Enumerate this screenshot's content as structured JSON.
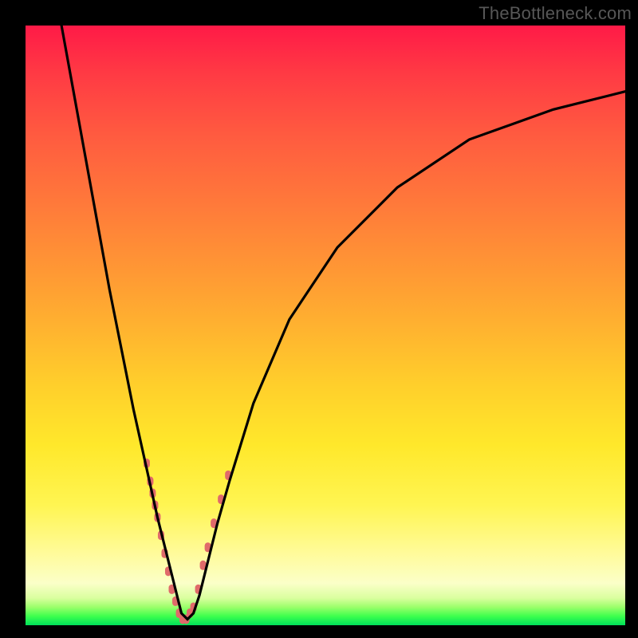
{
  "watermark": "TheBottleneck.com",
  "colors": {
    "background": "#000000",
    "gradient_top": "#ff1a47",
    "gradient_bottom": "#00e05a",
    "curve_stroke": "#000000",
    "marker_fill": "#e06a6a"
  },
  "chart_data": {
    "type": "line",
    "title": "",
    "xlabel": "",
    "ylabel": "",
    "xlim": [
      0,
      100
    ],
    "ylim": [
      0,
      100
    ],
    "note": "V-shaped bottleneck curve; x is normalized component ratio (0–100), y is bottleneck percentage (0 = none, 100 = severe). Minimum (no bottleneck) near x ≈ 26.",
    "series": [
      {
        "name": "bottleneck_curve",
        "x": [
          6,
          8,
          10,
          12,
          14,
          16,
          18,
          20,
          22,
          23,
          24,
          25,
          26,
          27,
          28,
          29,
          30,
          32,
          34,
          38,
          44,
          52,
          62,
          74,
          88,
          100
        ],
        "y": [
          100,
          89,
          78,
          67,
          56,
          46,
          36,
          27,
          18,
          14,
          10,
          6,
          2,
          1,
          2,
          5,
          9,
          17,
          24,
          37,
          51,
          63,
          73,
          81,
          86,
          89
        ]
      }
    ],
    "markers": {
      "name": "highlighted_points",
      "note": "Salmon rounded markers clustered near the minimum and lower flanks of the V.",
      "points": [
        {
          "x": 20.2,
          "y": 27
        },
        {
          "x": 20.8,
          "y": 24
        },
        {
          "x": 21.2,
          "y": 22
        },
        {
          "x": 21.6,
          "y": 20
        },
        {
          "x": 22.0,
          "y": 18
        },
        {
          "x": 22.6,
          "y": 15
        },
        {
          "x": 23.2,
          "y": 12
        },
        {
          "x": 23.8,
          "y": 9
        },
        {
          "x": 24.4,
          "y": 6
        },
        {
          "x": 25.0,
          "y": 4
        },
        {
          "x": 25.6,
          "y": 2
        },
        {
          "x": 26.2,
          "y": 1
        },
        {
          "x": 26.8,
          "y": 1
        },
        {
          "x": 27.4,
          "y": 2
        },
        {
          "x": 28.0,
          "y": 3
        },
        {
          "x": 28.8,
          "y": 6
        },
        {
          "x": 29.6,
          "y": 10
        },
        {
          "x": 30.4,
          "y": 13
        },
        {
          "x": 31.4,
          "y": 17
        },
        {
          "x": 32.6,
          "y": 21
        },
        {
          "x": 33.8,
          "y": 25
        }
      ]
    }
  }
}
